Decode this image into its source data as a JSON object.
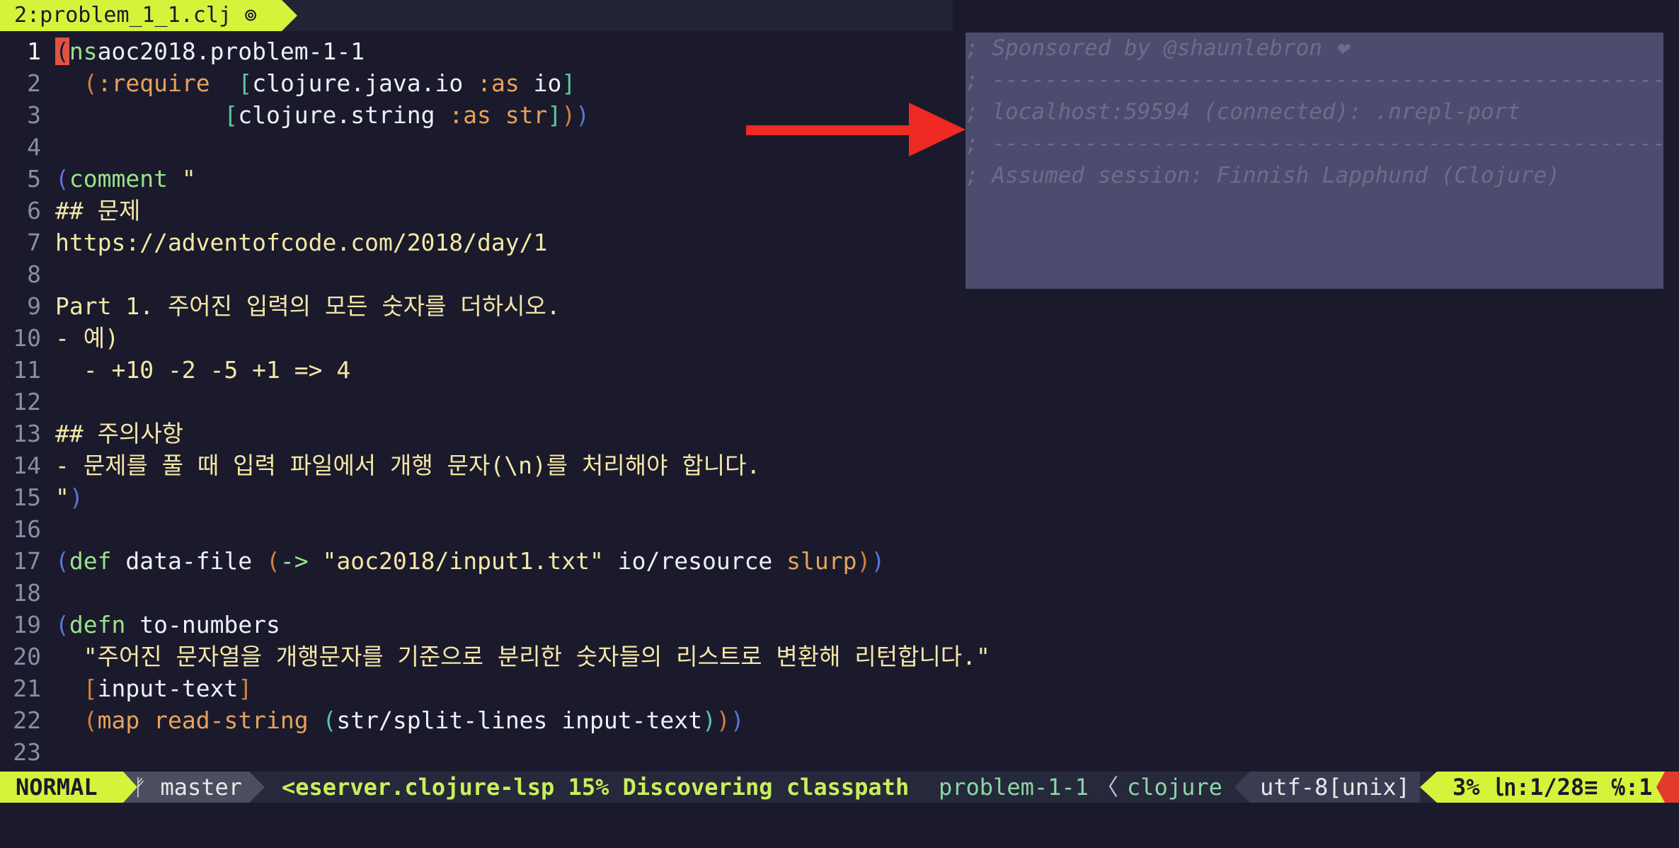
{
  "tab": {
    "label": "2:problem_1_1.clj ⊚"
  },
  "editor": {
    "current_line": "1",
    "lines": [
      {
        "n": "1",
        "parts": [
          [
            "cursor",
            "("
          ],
          [
            "kw",
            "ns"
          ],
          [
            "",
            "aoc2018.problem-1-1"
          ]
        ]
      },
      {
        "n": "2",
        "parts": [
          [
            "",
            "  "
          ],
          [
            "p2",
            "("
          ],
          [
            "sym",
            ":require"
          ],
          [
            "",
            "  "
          ],
          [
            "p3",
            "["
          ],
          [
            "",
            "clojure.java.io "
          ],
          [
            "sym",
            ":as"
          ],
          [
            "",
            " io"
          ],
          [
            "p3",
            "]"
          ]
        ]
      },
      {
        "n": "3",
        "parts": [
          [
            "",
            "            "
          ],
          [
            "p3",
            "["
          ],
          [
            "",
            "clojure.string "
          ],
          [
            "sym",
            ":as"
          ],
          [
            "",
            " "
          ],
          [
            "sym",
            "str"
          ],
          [
            "p3",
            "]"
          ],
          [
            "p2",
            ")"
          ],
          [
            "p1",
            ")"
          ]
        ]
      },
      {
        "n": "4",
        "parts": []
      },
      {
        "n": "5",
        "parts": [
          [
            "p1",
            "("
          ],
          [
            "kw",
            "comment"
          ],
          [
            "",
            " "
          ],
          [
            "str",
            "\""
          ]
        ]
      },
      {
        "n": "6",
        "parts": [
          [
            "str",
            "## 문제"
          ]
        ]
      },
      {
        "n": "7",
        "parts": [
          [
            "str",
            "https://adventofcode.com/2018/day/1"
          ]
        ]
      },
      {
        "n": "8",
        "parts": []
      },
      {
        "n": "9",
        "parts": [
          [
            "str",
            "Part 1. 주어진 입력의 모든 숫자를 더하시오."
          ]
        ]
      },
      {
        "n": "10",
        "parts": [
          [
            "str",
            "- 예)"
          ]
        ]
      },
      {
        "n": "11",
        "parts": [
          [
            "str",
            "  - +10 -2 -5 +1 => 4"
          ]
        ]
      },
      {
        "n": "12",
        "parts": []
      },
      {
        "n": "13",
        "parts": [
          [
            "str",
            "## 주의사항"
          ]
        ]
      },
      {
        "n": "14",
        "parts": [
          [
            "str",
            "- 문제를 풀 때 입력 파일에서 개행 문자(\\n)를 처리해야 합니다."
          ]
        ]
      },
      {
        "n": "15",
        "parts": [
          [
            "str",
            "\""
          ],
          [
            "p1",
            ")"
          ]
        ]
      },
      {
        "n": "16",
        "parts": []
      },
      {
        "n": "17",
        "parts": [
          [
            "p1",
            "("
          ],
          [
            "kw",
            "def"
          ],
          [
            "",
            " data-file "
          ],
          [
            "p2",
            "("
          ],
          [
            "kw",
            "->"
          ],
          [
            "",
            " "
          ],
          [
            "str",
            "\"aoc2018/input1.txt\""
          ],
          [
            "",
            " io/resource "
          ],
          [
            "rec",
            "slurp"
          ],
          [
            "p2",
            ")"
          ],
          [
            "p1",
            ")"
          ]
        ]
      },
      {
        "n": "18",
        "parts": []
      },
      {
        "n": "19",
        "parts": [
          [
            "p1",
            "("
          ],
          [
            "kw",
            "defn"
          ],
          [
            "",
            " to-numbers"
          ]
        ]
      },
      {
        "n": "20",
        "parts": [
          [
            "",
            "  "
          ],
          [
            "str",
            "\"주어진 문자열을 개행문자를 기준으로 분리한 숫자들의 리스트로 변환해 리턴합니다.\""
          ]
        ]
      },
      {
        "n": "21",
        "parts": [
          [
            "",
            "  "
          ],
          [
            "p2",
            "["
          ],
          [
            "",
            "input-text"
          ],
          [
            "p2",
            "]"
          ]
        ]
      },
      {
        "n": "22",
        "parts": [
          [
            "",
            "  "
          ],
          [
            "p2",
            "("
          ],
          [
            "rec",
            "map"
          ],
          [
            "",
            " "
          ],
          [
            "rec",
            "read-string"
          ],
          [
            "",
            " "
          ],
          [
            "p3",
            "("
          ],
          [
            "",
            "str/split-lines input-text"
          ],
          [
            "p3",
            ")"
          ],
          [
            "p2",
            ")"
          ],
          [
            "p1",
            ")"
          ]
        ]
      },
      {
        "n": "23",
        "parts": []
      }
    ]
  },
  "repl_overlay": {
    "lines": [
      "; Sponsored by @shaunlebron ❤",
      "; -----------------------------------------------------------------",
      "; localhost:59594 (connected): .nrepl-port",
      "; -----------------------------------------------------------------",
      "; Assumed session: Finnish Lapphund (Clojure)"
    ]
  },
  "statusline": {
    "mode": "NORMAL",
    "branch": "ᚠ master",
    "lsp_progress": "<eserver.clojure-lsp 15% Discovering classpath",
    "filename": "problem-1-1",
    "separator": "〈",
    "filetype": "clojure",
    "encoding": "utf-8[unix]",
    "position": "3% ㏑:1/28≡ ℅:1"
  },
  "colors": {
    "accent": "#d7f23a",
    "background": "#1a1a2c",
    "arrow": "#ee2a22"
  }
}
